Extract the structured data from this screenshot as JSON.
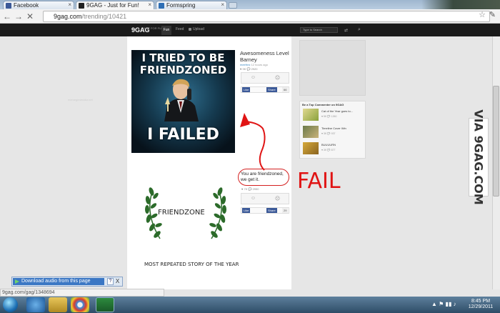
{
  "browser": {
    "tabs": [
      {
        "label": "Facebook",
        "icon": "facebook-icon",
        "color": "#3b5998"
      },
      {
        "label": "9GAG - Just for Fun!",
        "icon": "9gag-icon",
        "color": "#222222"
      },
      {
        "label": "Formspring",
        "icon": "formspring-icon",
        "color": "#2f6fb5"
      }
    ],
    "address": {
      "host": "9gag.com",
      "path": "/trending/10421"
    },
    "status_url": "9gag.com/gag/1348694"
  },
  "site": {
    "logo": "9GAG",
    "logo_sub": "JUST FOR FUN",
    "nav": [
      "Fun",
      "Feed",
      "Upload"
    ],
    "search_placeholder": "Type to Search"
  },
  "posts": [
    {
      "title": "Awesomeness Level Barney",
      "user": "meefrez",
      "time": "12 hours ago",
      "stats": "♥ 9K   💬 2920",
      "meme": {
        "top1": "I TRIED TO BE",
        "top2": "FRIENDZONED",
        "bottom": "I FAILED",
        "credit": "memegenerator.net"
      },
      "like": "Like",
      "share": "Share",
      "share_count": "66"
    },
    {
      "title": "You are friendzoned, we get it.",
      "stats": "♥ 7K   💬 2950",
      "meme": {
        "word": "FRIENDZONE",
        "caption": "MOST REPEATED STORY OF THE YEAR"
      },
      "like": "Like",
      "share": "Share",
      "share_count": "29"
    }
  ],
  "annotation": {
    "fail_text": "FAIL"
  },
  "sidebar": {
    "commenters_title": "Be a Top Commenter on 9GAG",
    "items": [
      {
        "title": "Cat of the Year goes to...",
        "stats": "♥ 5K  💬 1260"
      },
      {
        "title": "Timeline Cover Win",
        "stats": "♥ 3K  💬 937"
      },
      {
        "title": "BUUUURN",
        "stats": "♥ 3K  💬 877"
      }
    ]
  },
  "watermark": "VIA 9GAG.COM",
  "download_bar": {
    "label": "Download audio from this page",
    "help": "?",
    "close": "X"
  },
  "taskbar": {
    "time": "8:45 PM",
    "date": "12/29/2011"
  },
  "colors": {
    "fail_red": "#e01414",
    "site_bar": "#1b1b1b",
    "facebook_blue": "#3b5998"
  }
}
